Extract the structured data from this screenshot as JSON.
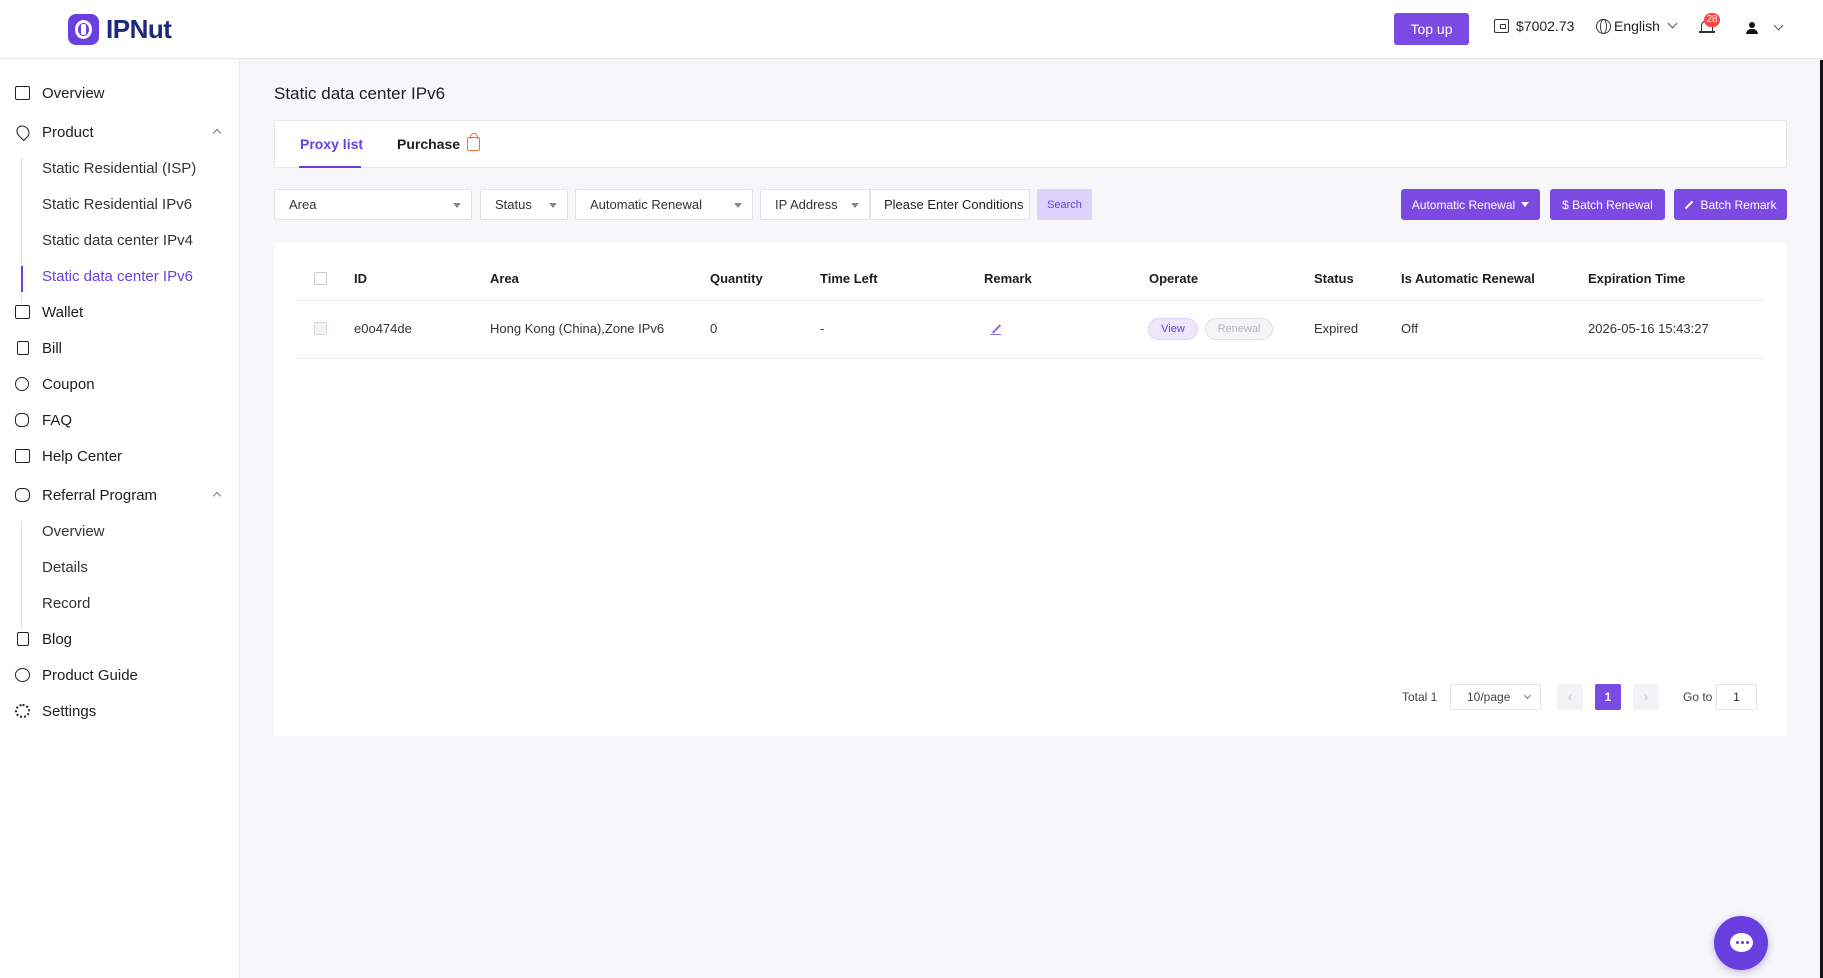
{
  "brand": {
    "name": "IPNut"
  },
  "header": {
    "topup_label": "Top up",
    "balance": "$7002.73",
    "language": "English",
    "notification_count": "28"
  },
  "sidebar": {
    "overview": "Overview",
    "product": "Product",
    "product_items": [
      "Static Residential (ISP)",
      "Static Residential IPv6",
      "Static data center IPv4",
      "Static data center IPv6"
    ],
    "wallet": "Wallet",
    "bill": "Bill",
    "coupon": "Coupon",
    "faq": "FAQ",
    "help_center": "Help Center",
    "referral": "Referral Program",
    "referral_items": [
      "Overview",
      "Details",
      "Record"
    ],
    "blog": "Blog",
    "product_guide": "Product Guide",
    "settings": "Settings"
  },
  "page": {
    "title": "Static data center IPv6",
    "tabs": [
      "Proxy list",
      "Purchase"
    ]
  },
  "filters": {
    "area": "Area",
    "status": "Status",
    "auto_renewal": "Automatic Renewal",
    "ip_type": "IP Address",
    "condition_placeholder": "Please Enter Conditions",
    "search_label": "Search"
  },
  "actions": {
    "auto_renewal": "Automatic Renewal",
    "batch_renewal": "$ Batch Renewal",
    "batch_remark": "Batch Remark"
  },
  "table": {
    "columns": [
      "ID",
      "Area",
      "Quantity",
      "Time Left",
      "Remark",
      "Operate",
      "Status",
      "Is Automatic Renewal",
      "Expiration Time"
    ],
    "rows": [
      {
        "id": "e0o474de",
        "area": "Hong Kong (China),Zone IPv6",
        "quantity": "0",
        "time_left": "-",
        "view": "View",
        "renewal": "Renewal",
        "status": "Expired",
        "auto_renewal": "Off",
        "expiration": "2026-05-16 15:43:27"
      }
    ]
  },
  "pagination": {
    "total": "Total 1",
    "page_size": "10/page",
    "current": "1",
    "goto_label": "Go to",
    "goto_value": "1"
  },
  "colors": {
    "accent": "#7b4ae2",
    "brand_text": "#1e2a78"
  }
}
